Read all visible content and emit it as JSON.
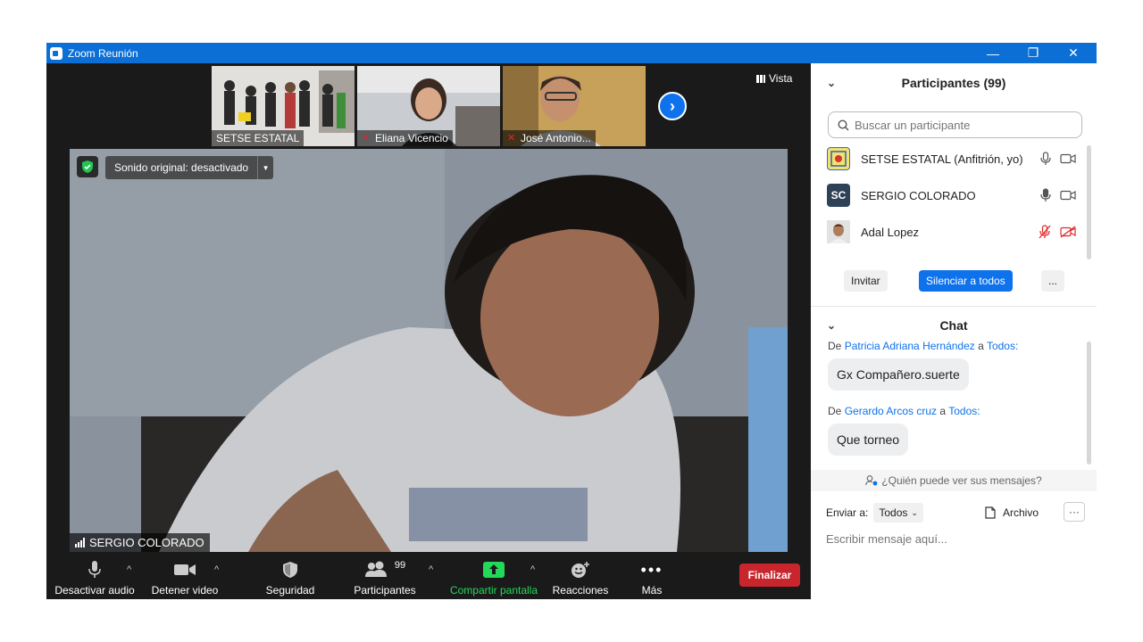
{
  "window": {
    "title": "Zoom Reunión",
    "minimize": "—",
    "restore": "❐",
    "close": "✕"
  },
  "vista_label": "Vista",
  "thumbnails": [
    {
      "name": "SETSE ESTATAL",
      "muted": false
    },
    {
      "name": "Eliana Vicencio",
      "muted": true
    },
    {
      "name": "José Antonio...",
      "muted": true
    }
  ],
  "main_video": {
    "sound_label": "Sonido original: desactivado",
    "speaker_name": "SERGIO COLORADO"
  },
  "toolbar": {
    "audio": "Desactivar audio",
    "video": "Detener video",
    "security": "Seguridad",
    "participants": "Participantes",
    "participants_count": "99",
    "share": "Compartir pantalla",
    "reactions": "Reacciones",
    "more": "Más",
    "end": "Finalizar"
  },
  "participants_panel": {
    "title": "Participantes (99)",
    "search_placeholder": "Buscar un participante",
    "items": [
      {
        "name": "SETSE ESTATAL (Anfitrión, yo)",
        "initials": "",
        "mic_muted": false,
        "video_off": false
      },
      {
        "name": "SERGIO COLORADO",
        "initials": "SC",
        "mic_muted": false,
        "video_off": false
      },
      {
        "name": "Adal Lopez",
        "initials": "",
        "mic_muted": true,
        "video_off": true
      }
    ],
    "invite": "Invitar",
    "mute_all": "Silenciar a todos",
    "more": "..."
  },
  "chat": {
    "title": "Chat",
    "messages": [
      {
        "prefix": "De",
        "from": "Patricia Adriana Hernández",
        "to_word": "a",
        "to": "Todos:",
        "text": "Gx Compañero.suerte"
      },
      {
        "prefix": "De",
        "from": "Gerardo Arcos cruz",
        "to_word": "a",
        "to": "Todos:",
        "text": "Que torneo"
      }
    ],
    "who_can_see": "¿Quién puede ver sus mensajes?",
    "send_to_label": "Enviar a:",
    "send_to_value": "Todos",
    "file_label": "Archivo",
    "input_placeholder": "Escribir mensaje aquí..."
  },
  "colors": {
    "accent": "#0e72ed",
    "titlebar": "#0b6fd6",
    "end": "#c9252c",
    "share": "#23d959",
    "muted": "#e02828"
  }
}
